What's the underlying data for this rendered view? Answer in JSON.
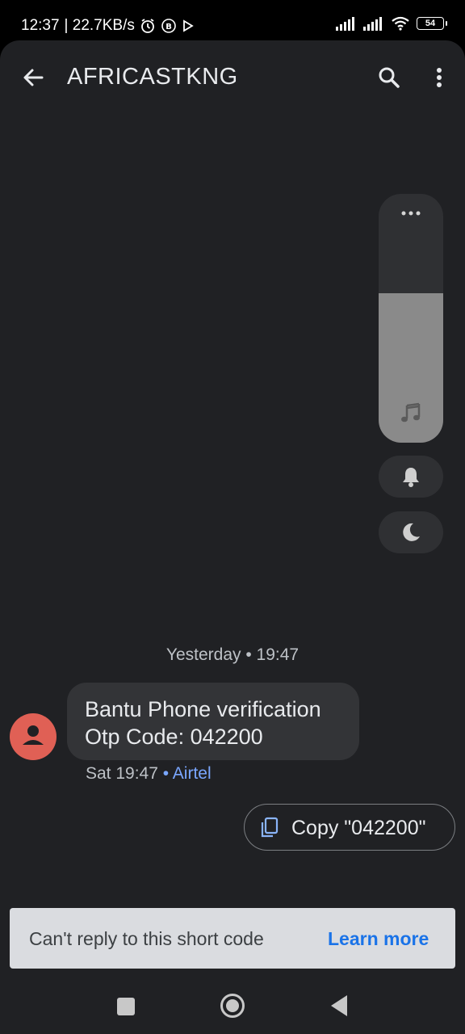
{
  "status_bar": {
    "time": "12:37",
    "speed": "| 22.7KB/s",
    "battery": "54"
  },
  "header": {
    "title": "AFRICASTKNG",
    "back_icon": "arrow-back-icon",
    "search_icon": "search-icon",
    "more_icon": "more-vert-icon"
  },
  "volume_panel": {
    "level": 0.6,
    "icons": [
      "more-horiz-icon",
      "music-note-icon",
      "bell-icon",
      "moon-icon"
    ]
  },
  "conversation": {
    "date_separator": "Yesterday • 19:47",
    "message": {
      "line1": "Bantu Phone verification",
      "line2": "Otp Code: 042200",
      "time": "Sat 19:47",
      "carrier": "• Airtel"
    },
    "copy_chip": "Copy \"042200\""
  },
  "snackbar": {
    "text": "Can't reply to this short code",
    "action": "Learn more"
  },
  "colors": {
    "background": "#202124",
    "avatar": "#e06055",
    "accent": "#1a73e8",
    "carrier": "#7aa7ff"
  }
}
